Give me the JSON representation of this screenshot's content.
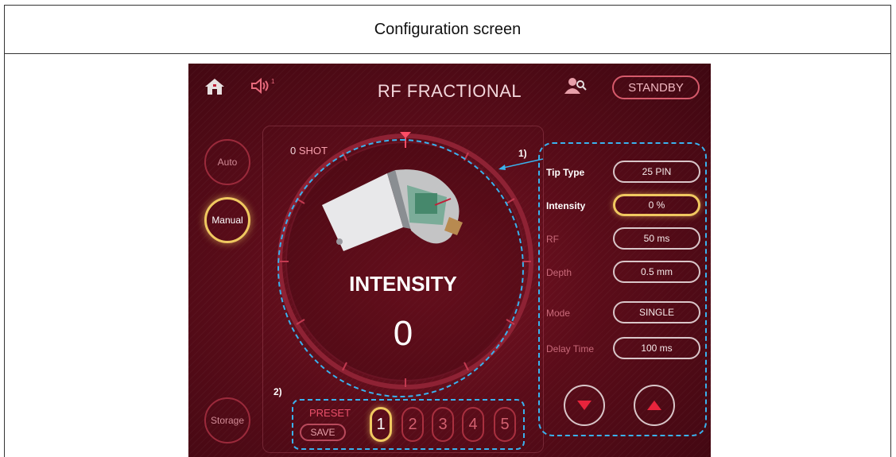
{
  "caption": "Configuration screen",
  "header": {
    "title": "RF FRACTIONAL",
    "volume_level": "1",
    "standby_label": "STANDBY"
  },
  "sidebar": {
    "auto_label": "Auto",
    "manual_label": "Manual",
    "storage_label": "Storage",
    "active": "Manual"
  },
  "shot": {
    "count": "0",
    "unit": "SHOT"
  },
  "dial": {
    "title": "INTENSITY",
    "value": "0"
  },
  "annotations": {
    "settings": "1)",
    "presets": "2)"
  },
  "settings": [
    {
      "label": "Tip Type",
      "value": "25 PIN",
      "active": false
    },
    {
      "label": "Intensity",
      "value": "0 %",
      "active": true
    },
    {
      "label": "RF",
      "value": "50 ms",
      "active": false
    },
    {
      "label": "Depth",
      "value": "0.5 mm",
      "active": false
    },
    {
      "label": "Mode",
      "value": "SINGLE",
      "active": false
    },
    {
      "label": "Delay Time",
      "value": "100 ms",
      "active": false
    }
  ],
  "preset": {
    "label": "PRESET",
    "save_label": "SAVE",
    "numbers": [
      "1",
      "2",
      "3",
      "4",
      "5"
    ],
    "selected": "1"
  },
  "colors": {
    "accent_gold": "#f0c860",
    "background": "#5a0c19",
    "annotation_blue": "#3ab2ee",
    "arrow_red": "#e8243c"
  },
  "icons": [
    "home-icon",
    "speaker-icon",
    "user-search-icon",
    "down-arrow-icon",
    "up-arrow-icon"
  ]
}
